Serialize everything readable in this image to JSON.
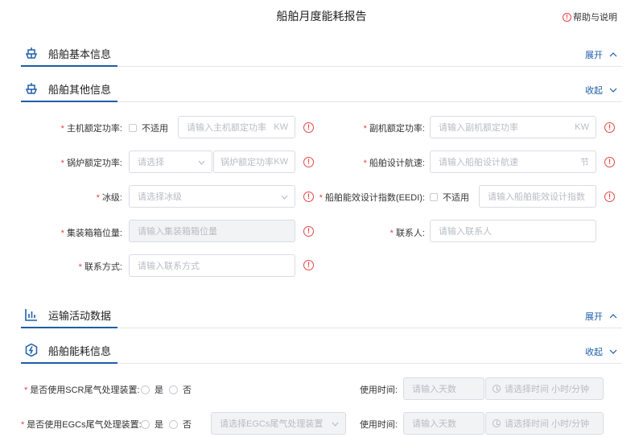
{
  "page": {
    "title": "船舶月度能耗报告",
    "help": "帮助与说明"
  },
  "sections": {
    "basic": {
      "label": "船舶基本信息",
      "toggle": "展开"
    },
    "other": {
      "label": "船舶其他信息",
      "toggle": "收起"
    },
    "transport": {
      "label": "运输活动数据",
      "toggle": "展开"
    },
    "energy": {
      "label": "船舶能耗信息",
      "toggle": "收起"
    }
  },
  "form": {
    "main_power": {
      "label": "主机额定功率:",
      "na": "不适用",
      "placeholder": "请输入主机额定功率",
      "unit": "KW"
    },
    "aux_power": {
      "label": "副机额定功率:",
      "placeholder": "请输入副机额定功率",
      "unit": "KW"
    },
    "boiler_power": {
      "label": "锅炉额定功率:",
      "select_placeholder": "请选择",
      "placeholder": "锅炉额定功率",
      "unit": "KW"
    },
    "design_speed": {
      "label": "船舶设计航速:",
      "placeholder": "请输入船舶设计航速",
      "unit": "节"
    },
    "ice_class": {
      "label": "冰级:",
      "placeholder": "请选择冰级"
    },
    "eedi": {
      "label": "船舶能效设计指数(EEDI):",
      "na": "不适用",
      "placeholder": "请输入船舶能效设计指数"
    },
    "container_slots": {
      "label": "集装箱箱位量:",
      "placeholder": "请输入集装箱箱位量"
    },
    "contact": {
      "label": "联系人:",
      "placeholder": "请输入联系人"
    },
    "contact_method": {
      "label": "联系方式:",
      "placeholder": "请输入联系方式"
    }
  },
  "energy": {
    "scr": {
      "label": "是否使用SCR尾气处理装置:",
      "yes": "是",
      "no": "否",
      "time_label": "使用时间:",
      "days_placeholder": "请输入天数",
      "time_placeholder": "请选择时间 小时/分钟"
    },
    "egcs": {
      "label": "是否使用EGCs尾气处理装置:",
      "yes": "是",
      "no": "否",
      "select_placeholder": "请选择EGCs尾气处理装置",
      "time_label": "使用时间:",
      "days_placeholder": "请输入天数",
      "time_placeholder": "请选择时间 小时/分钟"
    }
  },
  "colors": {
    "accent": "#1f5ea8",
    "required": "#e54545",
    "border": "#d9dce2"
  }
}
